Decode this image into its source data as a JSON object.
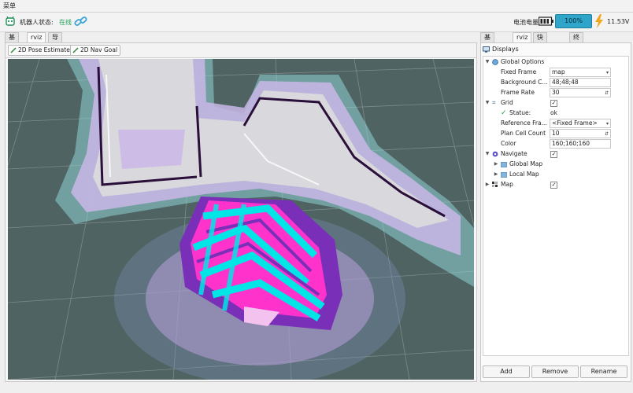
{
  "menu": {
    "title": "菜单"
  },
  "status": {
    "robot_label": "机器人状态:",
    "robot_state": "在线",
    "battery_label": "电池电量",
    "battery_percent_text": "100%",
    "battery_level": 1.0,
    "voltage": "11.53V",
    "online_color": "#20a05a",
    "battery_color": "#2fa6c9"
  },
  "left_tabs": [
    "基本",
    "rviz",
    "导航"
  ],
  "left_active_tab": "rviz",
  "right_tabs": [
    "基本控制",
    "rviz",
    "快捷指令",
    "终端"
  ],
  "right_active_tab": "rviz",
  "toolbar": {
    "pose_estimate": "2D Pose Estimate",
    "nav_goal": "2D Nav Goal"
  },
  "displays": {
    "header": "Displays",
    "global_options": "Global Options",
    "fixed_frame_label": "Fixed Frame",
    "fixed_frame_value": "map",
    "background_label": "Background C...",
    "background_value": "48;48;48",
    "frame_rate_label": "Frame Rate",
    "frame_rate_value": "30",
    "grid_label": "Grid",
    "status_label": "Statue:",
    "status_value": "ok",
    "ref_frame_label": "Reference Fra...",
    "ref_frame_value": "<Fixed Frame>",
    "plane_cell_label": "Plan Cell Count",
    "plane_cell_value": "10",
    "color_label": "Color",
    "color_value": "160;160;160",
    "navigate_label": "Navigate",
    "global_map_label": "Global Map",
    "local_map_label": "Local Map",
    "map_label": "Map"
  },
  "buttons": {
    "add": "Add",
    "remove": "Remove",
    "rename": "Rename"
  },
  "viewport": {
    "background_color": "#4f6363",
    "grid_color": "#a0a0a0",
    "costmap_colors": [
      "#00e5e5",
      "#ff33cc",
      "#7a2fb8",
      "#c9b7e8",
      "#8fd3d3"
    ]
  }
}
